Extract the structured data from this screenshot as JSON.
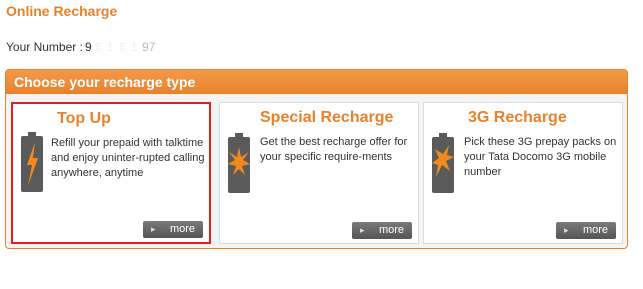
{
  "page": {
    "title": "Online Recharge"
  },
  "number": {
    "label": "Your Number :",
    "start": "9",
    "masked": "6 1 6 1",
    "end": "97"
  },
  "panel": {
    "header": "Choose your recharge type"
  },
  "cards": [
    {
      "title": "Top Up",
      "description": "Refill your prepaid with talktime and enjoy uninter-rupted calling anywhere, anytime",
      "more_label": "more",
      "icon": "battery-bolt-icon"
    },
    {
      "title": "Special Recharge",
      "description": "Get the best recharge offer for your specific require-ments",
      "more_label": "more",
      "icon": "battery-star-icon"
    },
    {
      "title": "3G Recharge",
      "description": "Pick these 3G prepay packs on your Tata Docomo 3G mobile number",
      "more_label": "more",
      "icon": "battery-burst-icon"
    }
  ],
  "colors": {
    "accent": "#e8822a",
    "selected_border": "#e02020",
    "button_gray": "#666666"
  }
}
